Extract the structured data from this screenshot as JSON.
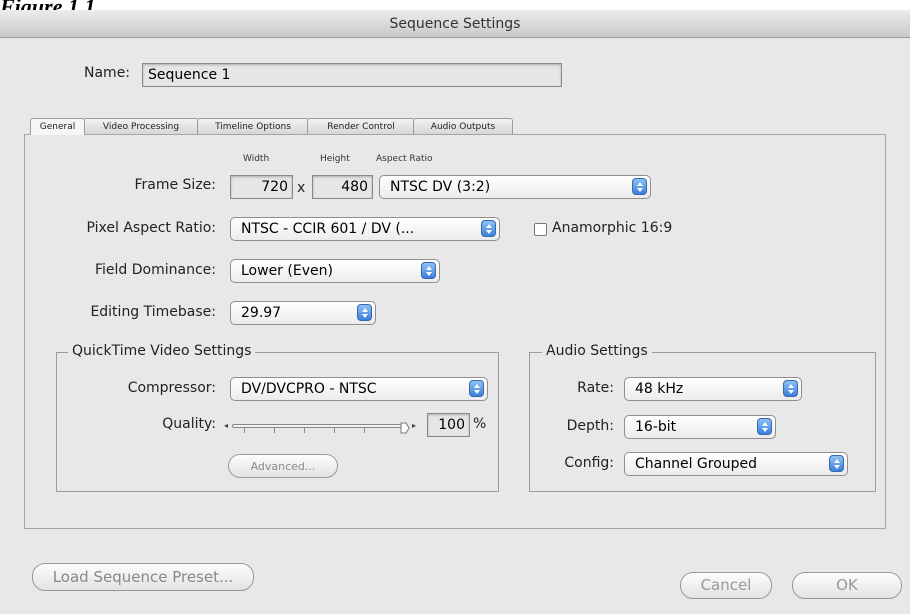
{
  "caption": "Figure 1.1",
  "window": {
    "title": "Sequence Settings"
  },
  "name_field": {
    "label": "Name:",
    "value": "Sequence 1"
  },
  "tabs": [
    {
      "label": "General",
      "active": true
    },
    {
      "label": "Video Processing"
    },
    {
      "label": "Timeline Options"
    },
    {
      "label": "Render Control"
    },
    {
      "label": "Audio Outputs"
    }
  ],
  "general": {
    "frame_size": {
      "label": "Frame Size:",
      "width_header": "Width",
      "height_header": "Height",
      "aspect_header": "Aspect Ratio",
      "width": "720",
      "x": "x",
      "height": "480",
      "aspect_ratio": "NTSC DV (3:2)"
    },
    "pixel_aspect": {
      "label": "Pixel Aspect Ratio:",
      "value": "NTSC - CCIR 601 / DV (...",
      "anamorphic_label": "Anamorphic 16:9",
      "anamorphic_checked": false
    },
    "field_dominance": {
      "label": "Field Dominance:",
      "value": "Lower (Even)"
    },
    "editing_timebase": {
      "label": "Editing Timebase:",
      "value": "29.97"
    },
    "quicktime": {
      "title": "QuickTime Video Settings",
      "compressor_label": "Compressor:",
      "compressor": "DV/DVCPRO - NTSC",
      "quality_label": "Quality:",
      "quality_value": "100",
      "quality_unit": "%",
      "quality_fraction": 1.0,
      "advanced_label": "Advanced..."
    },
    "audio": {
      "title": "Audio Settings",
      "rate_label": "Rate:",
      "rate": "48 kHz",
      "depth_label": "Depth:",
      "depth": "16-bit",
      "config_label": "Config:",
      "config": "Channel Grouped"
    }
  },
  "footer": {
    "load_preset": "Load Sequence Preset...",
    "cancel": "Cancel",
    "ok": "OK"
  },
  "colors": {
    "accent": "#3b80dd",
    "window_bg": "#e8e8e8"
  }
}
